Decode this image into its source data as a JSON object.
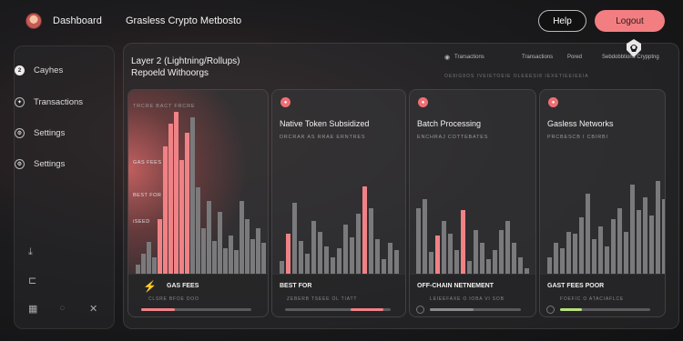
{
  "brand": {
    "name": "Dashboard"
  },
  "sidebar": {
    "items": [
      {
        "label": "Cayhes",
        "icon": "numbered-circle-icon",
        "badge": "2"
      },
      {
        "label": "Transactions",
        "icon": "sparkle-circle-icon"
      },
      {
        "label": "Settings",
        "icon": "gear-icon"
      },
      {
        "label": "Settings",
        "icon": "gear-icon"
      }
    ],
    "bottom_icons": [
      "download-icon",
      "document-icon",
      "grid-icon",
      "circle-icon",
      "close-icon"
    ]
  },
  "header": {
    "title": "Grasless Crypto Metbosto",
    "help_label": "Help",
    "logout_label": "Logout"
  },
  "section": {
    "title": "Layer 2 (Lightning/Rollups)",
    "subtitle": "Repoeld Withoorgs"
  },
  "top_tabs": [
    "Trarsactions",
    "Transactions",
    "Pored",
    "Sebdobbtions Crypptng"
  ],
  "tiny_row": "OE8IG8OS IVEIETOEIE OLEEESI8 IEXETIEEIEEIA",
  "colors": {
    "accent": "#f27e82",
    "bar": "#7a7a7c",
    "good": "#b8e07a"
  },
  "cards": [
    {
      "title": "",
      "subtitle": "TRCRE BACT FRCRE",
      "axis_labels": [
        "GAS FEES",
        "BEST FOR",
        "iSEED"
      ],
      "footer_label": "GAS FEES",
      "footer_sub": "CLSRE BFOE DOO",
      "footer_icon": "lightning-icon",
      "progress": 0.3
    },
    {
      "title": "Native Token Subsidized",
      "subtitle": "DRCRAR AS RRAE ERNTRES",
      "axis_labels": [],
      "footer_label": "BEST FOR",
      "footer_sub": "ZEBERB TSEEE OL TIATT",
      "progress": 0.3
    },
    {
      "title": "Batch Processing",
      "subtitle": "ENCHRAJ COTTEBATES",
      "axis_labels": [],
      "footer_label": "OFF-CHAIN NETNEMENT",
      "footer_sub": "LEIEEFAXE O IOBA VI SOB",
      "progress": 0.5
    },
    {
      "title": "Gasless Networks",
      "subtitle": "PRCBESCB I CBIRBI",
      "axis_labels": [],
      "footer_label": "GAST FEES POOR",
      "footer_sub": "FOEFIC O ATACIAFLCE",
      "progress": 0.25
    }
  ]
}
